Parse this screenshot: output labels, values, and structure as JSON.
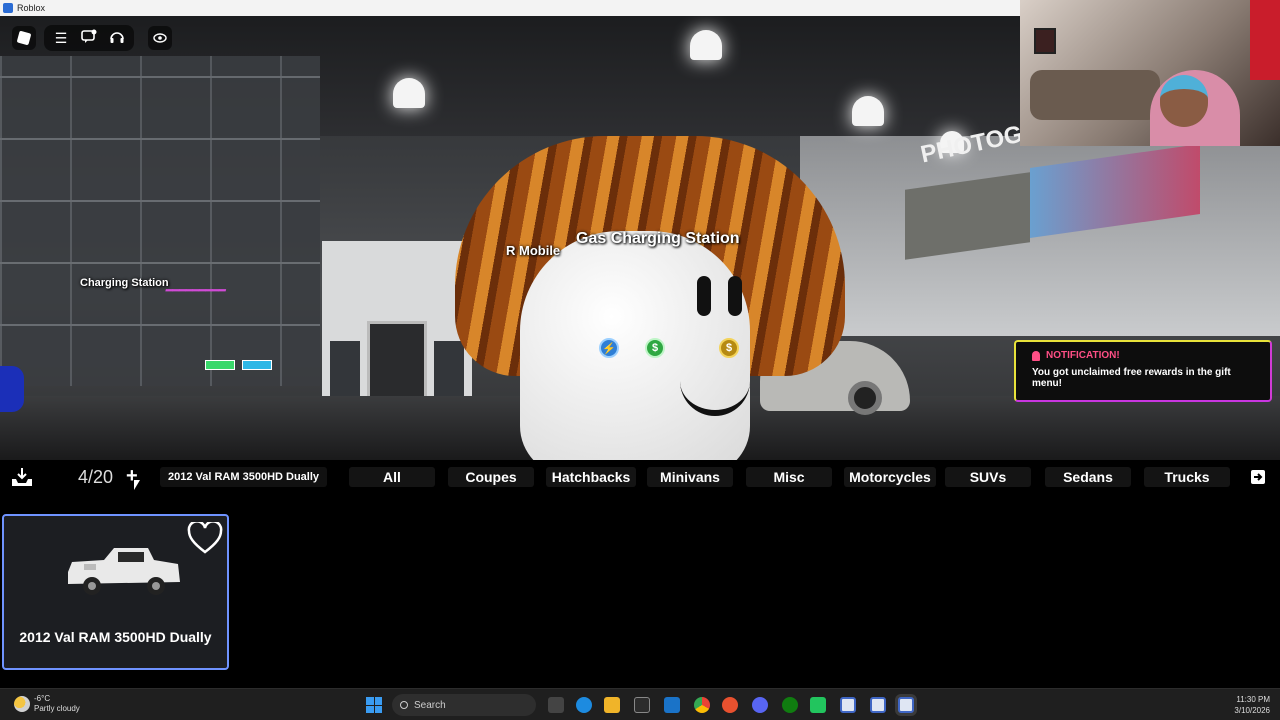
{
  "window": {
    "title": "Roblox"
  },
  "world": {
    "labels": {
      "charging_station": "Charging Station",
      "r_mobile": "R Mobile",
      "gas_station": "Gas Charging Station",
      "photo_sign": "PHOTOG"
    }
  },
  "menu": {
    "icons": [
      "roblox-logo-icon",
      "hamburger-menu-icon",
      "chat-icon",
      "headset-icon",
      "eye-icon"
    ]
  },
  "notification": {
    "header": "NOTIFICATION!",
    "message": "You got unclaimed free rewards in the gift menu!"
  },
  "garage": {
    "count": "4/20",
    "selected_vehicle": "2012 Val RAM 3500HD Dually",
    "categories": [
      "All",
      "Coupes",
      "Hatchbacks",
      "Minivans",
      "Misc",
      "Motorcycles",
      "SUVs",
      "Sedans",
      "Trucks"
    ],
    "vehicles": [
      {
        "name": "2012 Val RAM 3500HD Dually"
      }
    ]
  },
  "taskbar": {
    "weather_temp": "-6°C",
    "weather_desc": "Partly cloudy",
    "search_placeholder": "Search",
    "time": "11:30 PM",
    "date": "3/10/2026"
  }
}
